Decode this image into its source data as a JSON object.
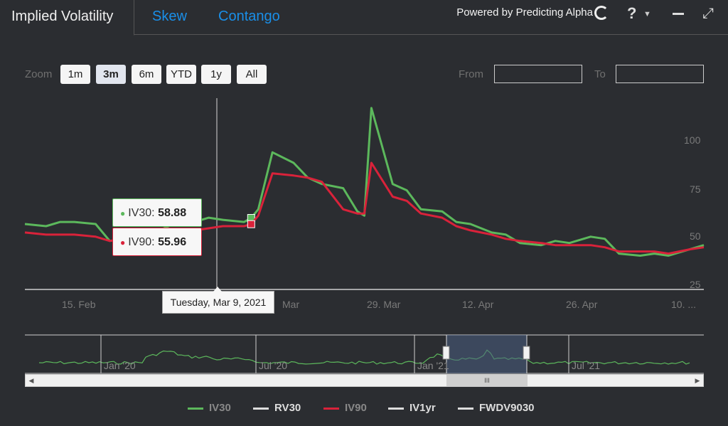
{
  "header": {
    "tabs": [
      {
        "label": "Implied Volatility",
        "active": true
      },
      {
        "label": "Skew",
        "active": false
      },
      {
        "label": "Contango",
        "active": false
      }
    ],
    "powered_by": "Powered by Predicting Alpha",
    "help_label": "?"
  },
  "range_selector": {
    "zoom_label": "Zoom",
    "buttons": [
      "1m",
      "3m",
      "6m",
      "YTD",
      "1y",
      "All"
    ],
    "active": "3m",
    "from_label": "From",
    "to_label": "To",
    "from_value": "",
    "to_value": ""
  },
  "colors": {
    "iv30": "#5cb85c",
    "iv90": "#d9223a",
    "rv30": "#dddddd",
    "iv1yr": "#dddddd",
    "fwdv9030": "#dddddd"
  },
  "tooltip": {
    "date": "Tuesday, Mar 9, 2021",
    "iv30_label": "IV30",
    "iv30_value": "58.88",
    "iv90_label": "IV90",
    "iv90_value": "55.96"
  },
  "chart_data": {
    "type": "line",
    "x_ticks": [
      "15. Feb",
      "Mar",
      "29. Mar",
      "12. Apr",
      "26. Apr",
      "10. ..."
    ],
    "y_ticks": [
      "25",
      "50",
      "75",
      "100"
    ],
    "ylim": [
      25,
      115
    ],
    "xlim": [
      "2021-02-05",
      "2021-05-12"
    ],
    "series": [
      {
        "name": "IV30",
        "x": [
          "2021-02-05",
          "2021-02-08",
          "2021-02-10",
          "2021-02-12",
          "2021-02-15",
          "2021-02-17",
          "2021-02-19",
          "2021-02-22",
          "2021-02-24",
          "2021-02-26",
          "2021-03-01",
          "2021-03-03",
          "2021-03-05",
          "2021-03-08",
          "2021-03-09",
          "2021-03-10",
          "2021-03-12",
          "2021-03-15",
          "2021-03-17",
          "2021-03-19",
          "2021-03-22",
          "2021-03-24",
          "2021-03-25",
          "2021-03-26",
          "2021-03-29",
          "2021-03-31",
          "2021-04-02",
          "2021-04-05",
          "2021-04-07",
          "2021-04-09",
          "2021-04-12",
          "2021-04-14",
          "2021-04-16",
          "2021-04-19",
          "2021-04-21",
          "2021-04-23",
          "2021-04-26",
          "2021-04-28",
          "2021-04-30",
          "2021-05-03",
          "2021-05-05",
          "2021-05-07",
          "2021-05-10",
          "2021-05-12"
        ],
        "y": [
          56,
          55,
          57,
          57,
          56,
          48,
          49,
          52,
          53,
          56,
          57,
          59,
          58,
          57,
          58.88,
          63,
          90,
          85,
          78,
          75,
          73,
          62,
          60,
          111,
          75,
          72,
          63,
          62,
          57,
          56,
          52,
          51,
          47,
          46,
          48,
          47,
          50,
          49,
          42,
          41,
          42,
          41,
          44,
          46
        ]
      },
      {
        "name": "IV90",
        "x": [
          "2021-02-05",
          "2021-02-08",
          "2021-02-10",
          "2021-02-12",
          "2021-02-15",
          "2021-02-17",
          "2021-02-19",
          "2021-02-22",
          "2021-02-24",
          "2021-02-26",
          "2021-03-01",
          "2021-03-03",
          "2021-03-05",
          "2021-03-08",
          "2021-03-09",
          "2021-03-10",
          "2021-03-12",
          "2021-03-15",
          "2021-03-17",
          "2021-03-19",
          "2021-03-22",
          "2021-03-24",
          "2021-03-25",
          "2021-03-26",
          "2021-03-29",
          "2021-03-31",
          "2021-04-02",
          "2021-04-05",
          "2021-04-07",
          "2021-04-09",
          "2021-04-12",
          "2021-04-14",
          "2021-04-16",
          "2021-04-19",
          "2021-04-21",
          "2021-04-23",
          "2021-04-26",
          "2021-04-28",
          "2021-04-30",
          "2021-05-03",
          "2021-05-05",
          "2021-05-07",
          "2021-05-10",
          "2021-05-12"
        ],
        "y": [
          52,
          51,
          51,
          51,
          50,
          48,
          49,
          50,
          51,
          52,
          53,
          54,
          55,
          55,
          55.96,
          60,
          80,
          79,
          78,
          76,
          63,
          61,
          61,
          85,
          69,
          67,
          61,
          59,
          55,
          53,
          51,
          49,
          48,
          47,
          46,
          46,
          46,
          45,
          43,
          43,
          43,
          42,
          44,
          45
        ]
      }
    ],
    "navigator": {
      "ticks": [
        "Jan '20",
        "Jul '20",
        "Jan '21",
        "Jul '21"
      ]
    },
    "legend": [
      {
        "name": "IV30",
        "enabled": true
      },
      {
        "name": "RV30",
        "enabled": false
      },
      {
        "name": "IV90",
        "enabled": true
      },
      {
        "name": "IV1yr",
        "enabled": false
      },
      {
        "name": "FWDV9030",
        "enabled": false
      }
    ]
  }
}
